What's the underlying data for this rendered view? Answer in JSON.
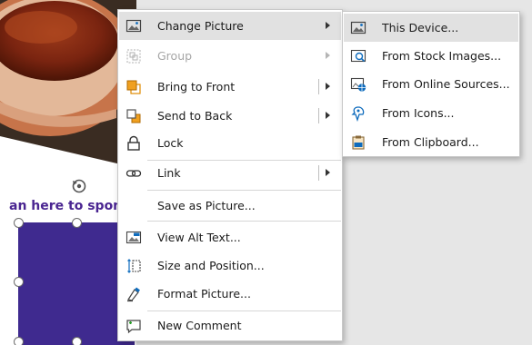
{
  "slide": {
    "text": "an here to spon"
  },
  "main_menu": {
    "items": [
      {
        "label": "Change Picture",
        "icon": "change-picture-icon"
      },
      {
        "label": "Group",
        "icon": "group-icon"
      },
      {
        "label": "Bring to Front",
        "icon": "bring-to-front-icon"
      },
      {
        "label": "Send to Back",
        "icon": "send-to-back-icon"
      },
      {
        "label": "Lock",
        "icon": "lock-icon"
      },
      {
        "label": "Link",
        "icon": "link-icon"
      },
      {
        "label": "Save as Picture...",
        "icon": ""
      },
      {
        "label": "View Alt Text...",
        "icon": "alt-text-icon"
      },
      {
        "label": "Size and Position...",
        "icon": "size-position-icon"
      },
      {
        "label": "Format Picture...",
        "icon": "format-picture-icon"
      },
      {
        "label": "New Comment",
        "icon": "new-comment-icon"
      }
    ]
  },
  "sub_menu": {
    "items": [
      {
        "label": "This Device...",
        "icon": "this-device-icon"
      },
      {
        "label": "From Stock Images...",
        "icon": "stock-images-icon"
      },
      {
        "label": "From Online Sources...",
        "icon": "online-sources-icon"
      },
      {
        "label": "From Icons...",
        "icon": "icons-icon"
      },
      {
        "label": "From Clipboard...",
        "icon": "clipboard-icon"
      }
    ]
  },
  "colors": {
    "accent": "#0f6cbd",
    "highlight": "#e1e1e1",
    "purple": "#3f2a8f"
  }
}
